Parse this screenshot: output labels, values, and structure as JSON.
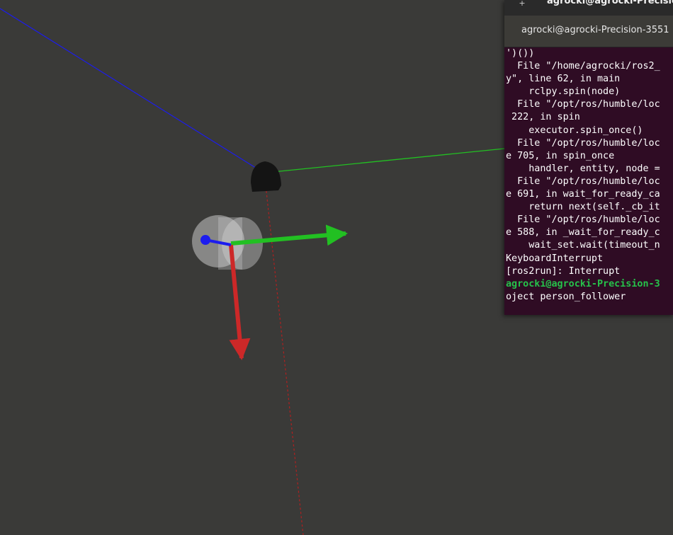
{
  "scene": {
    "colors": {
      "background": "#3a3a38",
      "x_axis": "#cc2828",
      "y_axis": "#22c022",
      "z_axis": "#1c1cee",
      "laser_ray": "#b02020",
      "cylinder": "#c8c8c8",
      "robot_body": "#141414"
    }
  },
  "terminal": {
    "newtab_icon": "+",
    "window_title": "agrocki@agrocki-Precisio",
    "tab_label": "agrocki@agrocki-Precision-3551",
    "lines": [
      {
        "text": "')())",
        "prompt": false
      },
      {
        "text": "  File \"/home/agrocki/ros2_",
        "prompt": false
      },
      {
        "text": "y\", line 62, in main",
        "prompt": false
      },
      {
        "text": "    rclpy.spin(node)",
        "prompt": false
      },
      {
        "text": "  File \"/opt/ros/humble/loc",
        "prompt": false
      },
      {
        "text": " 222, in spin",
        "prompt": false
      },
      {
        "text": "    executor.spin_once()",
        "prompt": false
      },
      {
        "text": "  File \"/opt/ros/humble/loc",
        "prompt": false
      },
      {
        "text": "e 705, in spin_once",
        "prompt": false
      },
      {
        "text": "    handler, entity, node =",
        "prompt": false
      },
      {
        "text": "  File \"/opt/ros/humble/loc",
        "prompt": false
      },
      {
        "text": "e 691, in wait_for_ready_ca",
        "prompt": false
      },
      {
        "text": "    return next(self._cb_it",
        "prompt": false
      },
      {
        "text": "  File \"/opt/ros/humble/loc",
        "prompt": false
      },
      {
        "text": "e 588, in _wait_for_ready_c",
        "prompt": false
      },
      {
        "text": "    wait_set.wait(timeout_n",
        "prompt": false
      },
      {
        "text": "KeyboardInterrupt",
        "prompt": false
      },
      {
        "text": "[ros2run]: Interrupt",
        "prompt": false
      },
      {
        "text": "agrocki@agrocki-Precision-3",
        "prompt": true
      },
      {
        "text": "oject person_follower",
        "prompt": false
      }
    ]
  }
}
